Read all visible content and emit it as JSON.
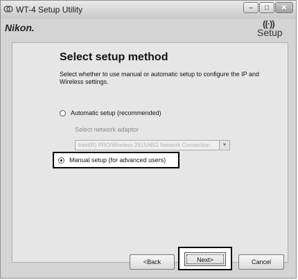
{
  "window": {
    "title": "WT-4 Setup Utility",
    "minimize_icon": "minimize-icon",
    "maximize_icon": "maximize-icon",
    "close_icon": "close-icon"
  },
  "header": {
    "brand": "Nikon.",
    "setup_logo_waves": "((·))",
    "setup_logo_word": "Setup"
  },
  "content": {
    "heading": "Select setup method",
    "description": "Select whether to use manual or automatic setup to configure the IP and Wireless settings.",
    "options": [
      {
        "label": "Automatic setup (recommended)",
        "selected": false
      },
      {
        "label": "Manual setup (for advanced users)",
        "selected": true
      }
    ],
    "adapter_label": "Select network adaptor",
    "adapter_value": "Intel(R) PRO/Wireless 2915ABG Network Connection"
  },
  "buttons": {
    "back": "<Back",
    "next": "Next>",
    "cancel": "Cancel"
  }
}
